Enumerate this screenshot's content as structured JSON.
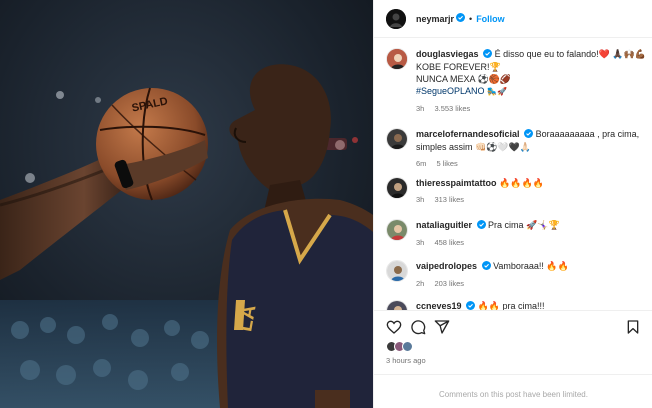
{
  "header": {
    "username": "neymarjr",
    "separator": "•",
    "follow_label": "Follow"
  },
  "caption": {
    "username": "douglasviegas",
    "line1": "É disso que eu to falando!❤️ 🙏🏿🙌🏾💪🏾",
    "line2": "KOBE FOREVER!🏆",
    "line3": "NUNCA MEXA ⚽️🏀🏈",
    "hashtag": "#SegueOPLANO",
    "hashtag_emoji": "🛼🚀",
    "time": "3h",
    "likes": "3.553 likes"
  },
  "comments": [
    {
      "username": "marcelofernandesoficial",
      "text": "Boraaaaaaaaa , pra cima, simples assim 👊🏻⚽️🤍🖤🙏🏻",
      "time": "6m",
      "likes": "5 likes"
    },
    {
      "username": "thieresspaimtattoo",
      "text": "🔥🔥🔥🔥",
      "time": "3h",
      "likes": "313 likes"
    },
    {
      "username": "nataliaguitler",
      "text": "Pra cima 🚀🤸🏼‍♀️🏆",
      "time": "3h",
      "likes": "458 likes"
    },
    {
      "username": "vaipedrolopes",
      "text": "Vamboraaa!! 🔥🔥",
      "time": "2h",
      "likes": "203 likes"
    },
    {
      "username": "ccneves19",
      "text": "🔥🔥 pra cima!!!",
      "time": "",
      "likes": ""
    }
  ],
  "footer": {
    "timestamp": "3 hours ago",
    "limited_notice": "Comments on this post have been limited."
  },
  "icons": {
    "like": "heart-icon",
    "comment": "comment-icon",
    "share": "share-icon",
    "save": "bookmark-icon",
    "verified": "verified-badge-icon"
  },
  "colors": {
    "accent": "#0095f6",
    "verified": "#0095f6",
    "hashtag": "#00376b",
    "muted": "#737373",
    "divider": "#efefef"
  }
}
